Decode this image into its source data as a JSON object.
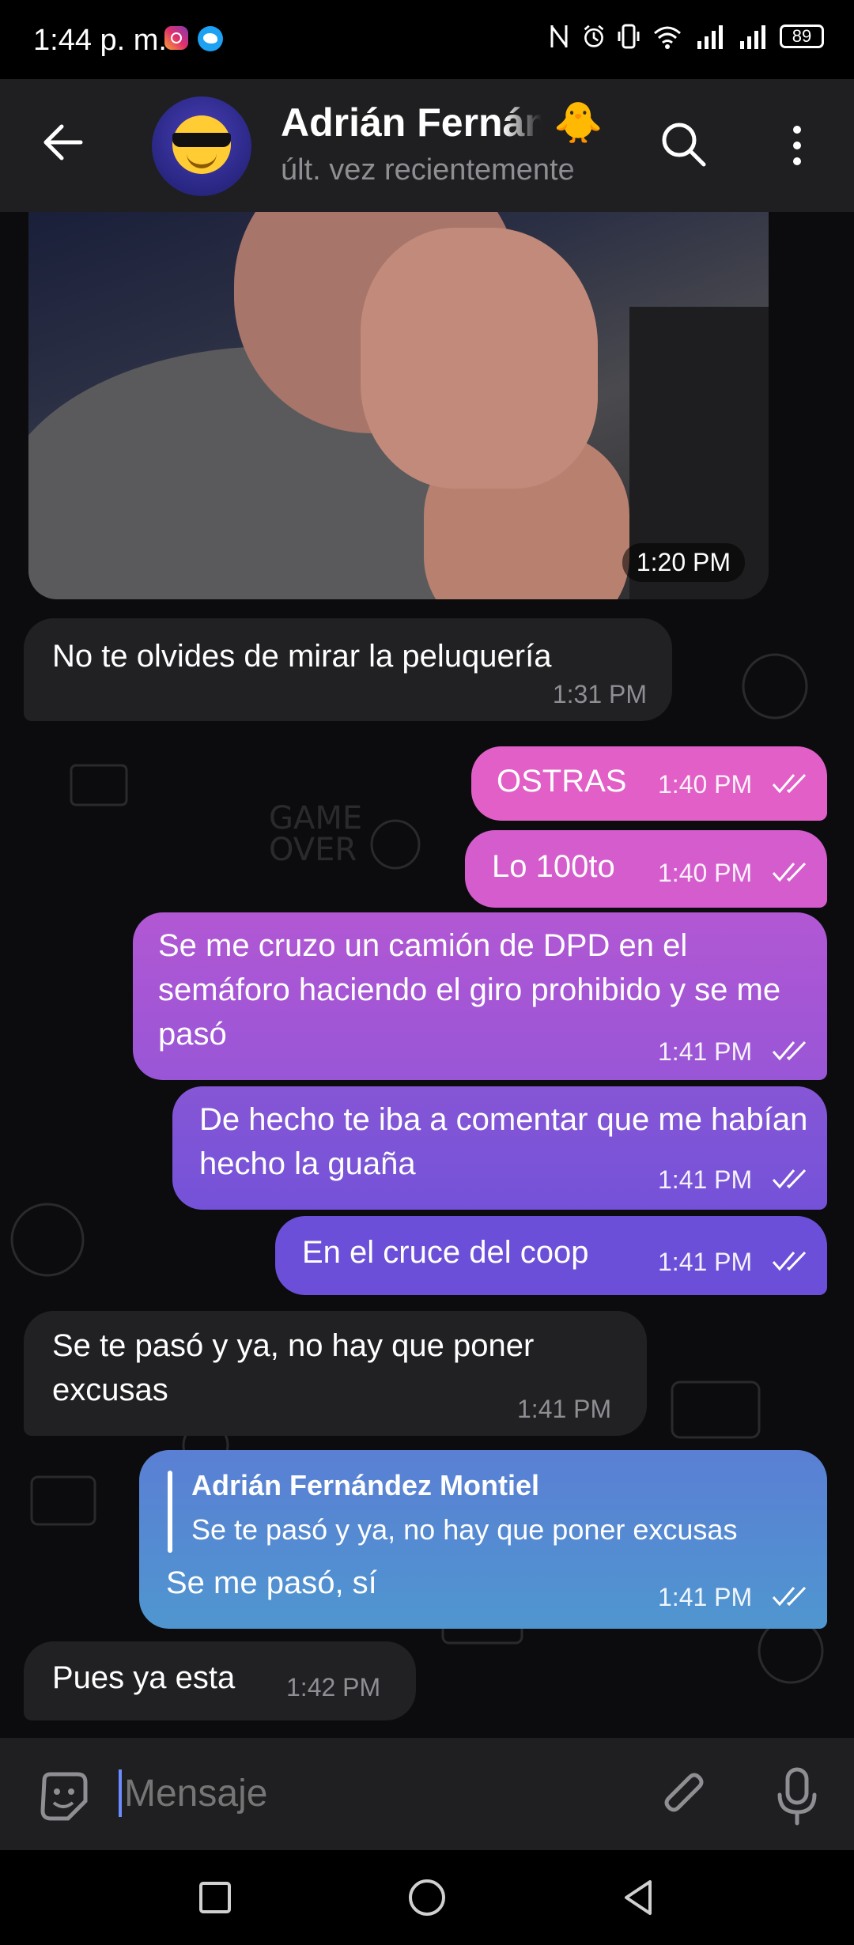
{
  "status_bar": {
    "time": "1:44 p. m.",
    "battery": "89",
    "icons": [
      "instagram-icon",
      "twitter-icon",
      "nfc-icon",
      "alarm-icon",
      "vibrate-icon",
      "wifi-icon",
      "signal-icon",
      "signal-icon",
      "battery-icon"
    ]
  },
  "header": {
    "name": "Adrián Fernández Montiel",
    "status": "últ. vez recientemente",
    "name_emoji": "🐥"
  },
  "media_message": {
    "time": "1:20 PM"
  },
  "messages": [
    {
      "dir": "in",
      "text": "No te olvides de mirar la peluquería",
      "time": "1:31 PM"
    },
    {
      "dir": "out",
      "text": "OSTRAS",
      "time": "1:40 PM"
    },
    {
      "dir": "out",
      "text": "Lo 100to",
      "time": "1:40 PM"
    },
    {
      "dir": "out",
      "text": "Se me cruzo un camión de DPD en el semáforo haciendo el giro prohibido y se me pasó",
      "time": "1:41 PM"
    },
    {
      "dir": "out",
      "text": "De hecho te iba a comentar que me habían hecho la guaña",
      "time": "1:41 PM"
    },
    {
      "dir": "out",
      "text": "En el cruce del coop",
      "time": "1:41 PM"
    },
    {
      "dir": "in",
      "text": "Se te pasó y ya, no hay que poner excusas",
      "time": "1:41 PM"
    },
    {
      "dir": "out",
      "text": "Se me pasó, sí",
      "time": "1:41 PM",
      "reply": {
        "name": "Adrián Fernández Montiel",
        "text": "Se te pasó y ya, no hay que poner excusas"
      }
    },
    {
      "dir": "in",
      "text": "Pues ya esta",
      "time": "1:42 PM"
    }
  ],
  "input": {
    "placeholder": "Mensaje"
  },
  "colors": {
    "outgoing_gradient": [
      "#e45fc4",
      "#c35ad4",
      "#8f58d6",
      "#6f4fd8",
      "#5a7fd0",
      "#4f96d0"
    ],
    "incoming_bubble": "#212124",
    "header_bg": "#1f1f21",
    "cursor": "#6a8cff"
  }
}
